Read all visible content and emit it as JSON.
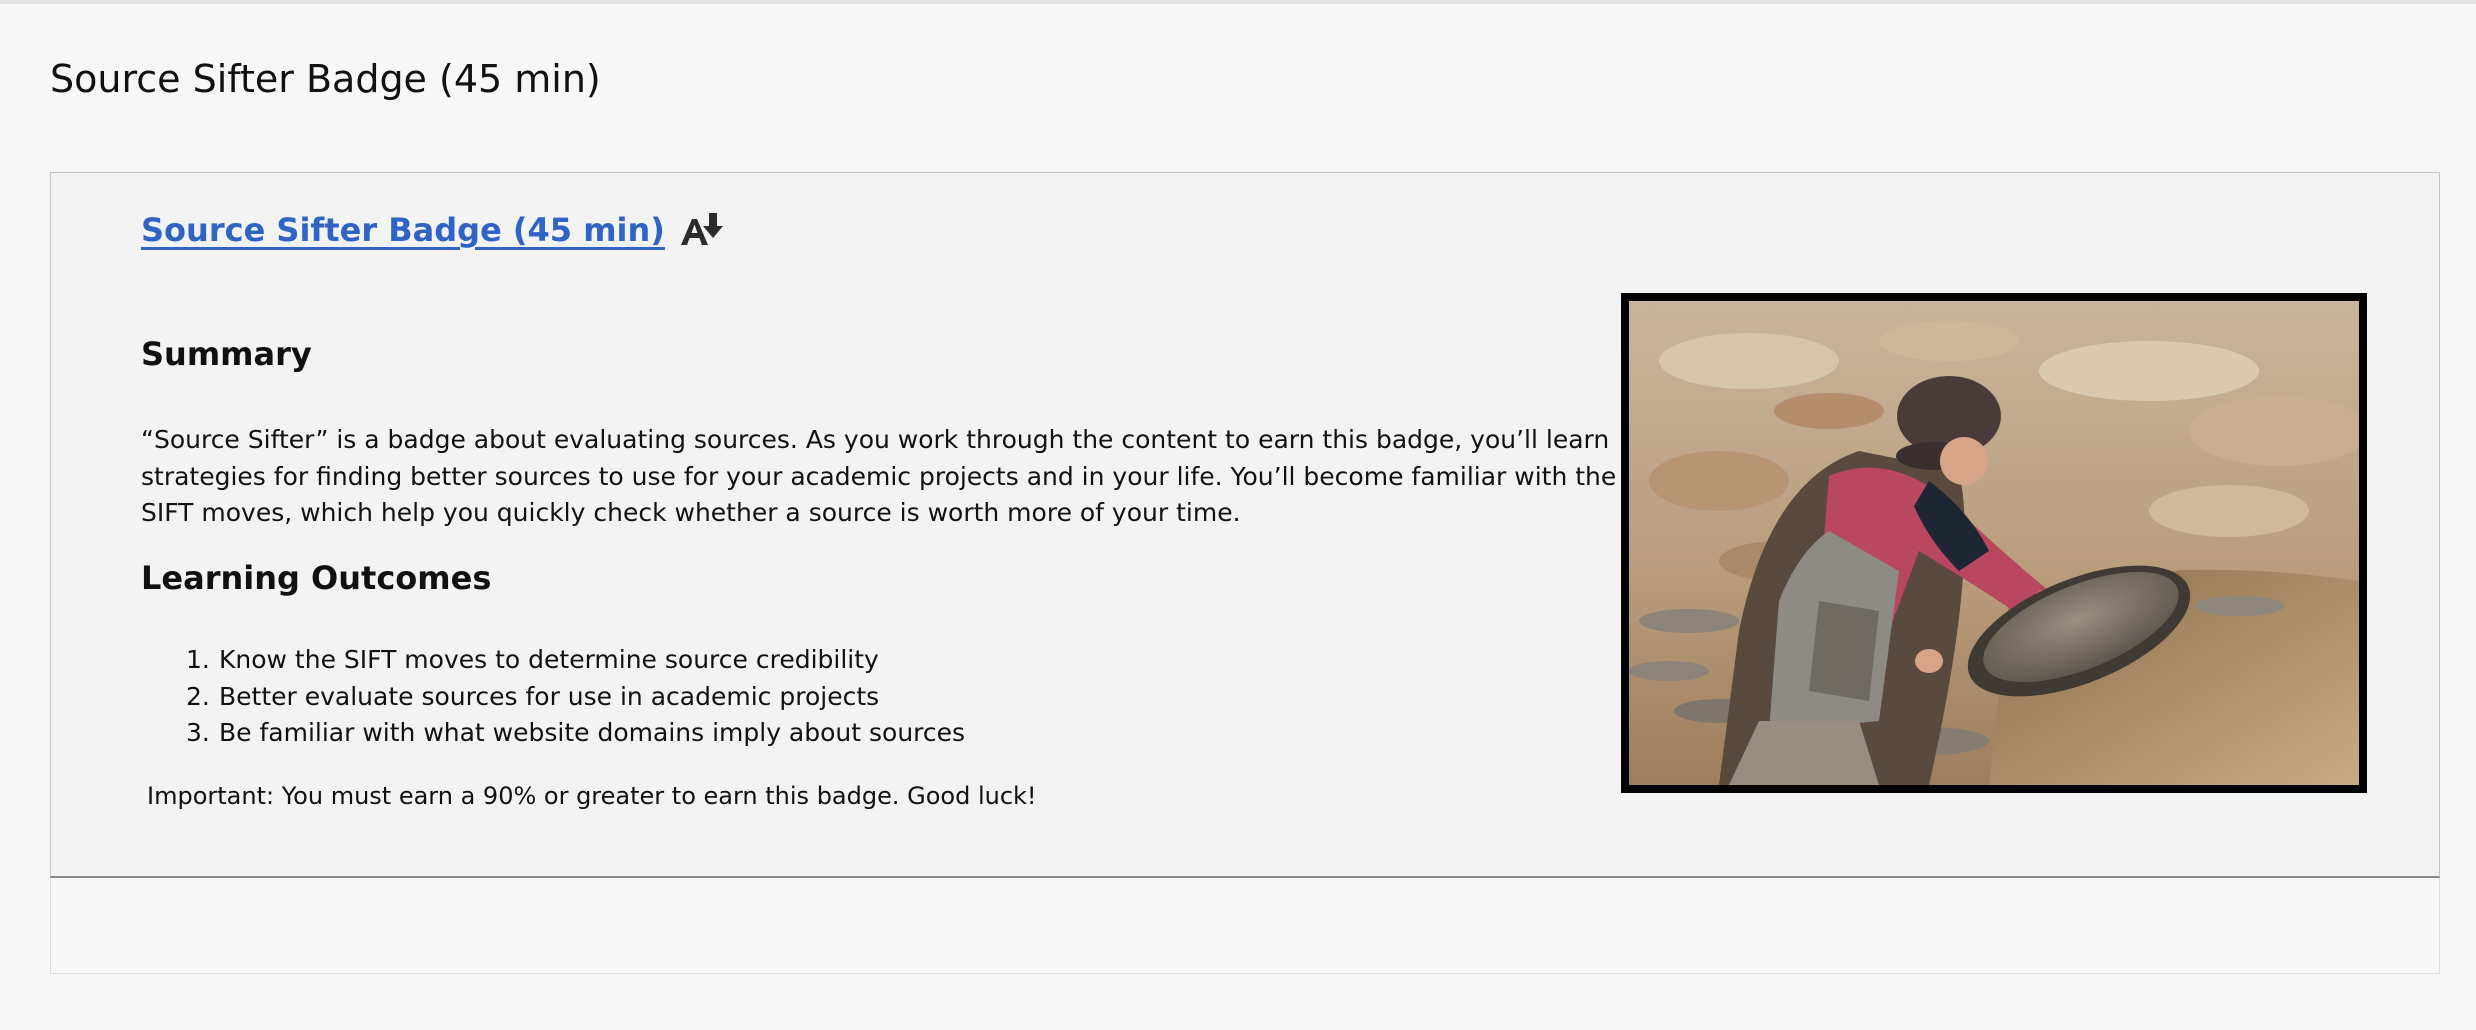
{
  "page": {
    "title": "Source Sifter Badge (45 min)"
  },
  "card": {
    "link_text": "Source Sifter Badge (45 min)",
    "link_icon": "alternate-formats-icon",
    "summary_heading": "Summary",
    "summary_text": "“Source Sifter” is a badge about evaluating sources. As you work through the content to earn this badge, you’ll learn strategies for finding better sources to use for your academic projects and in your life. You’ll become familiar with the SIFT moves, which help you quickly check whether a source is worth more of your time.",
    "outcomes_heading": "Learning Outcomes",
    "outcomes": [
      {
        "num": "1.",
        "text": "Know the SIFT moves to determine source credibility"
      },
      {
        "num": "2.",
        "text": "Better evaluate sources for use in academic projects"
      },
      {
        "num": "3.",
        "text": "Be familiar with what website domains imply about sources"
      }
    ],
    "important_text": "Important: You must earn a 90% or greater to earn this badge. Good luck!"
  },
  "colors": {
    "link": "#2f64c4",
    "page_bg": "#f7f7f7",
    "card_bg": "#f3f3f3"
  }
}
